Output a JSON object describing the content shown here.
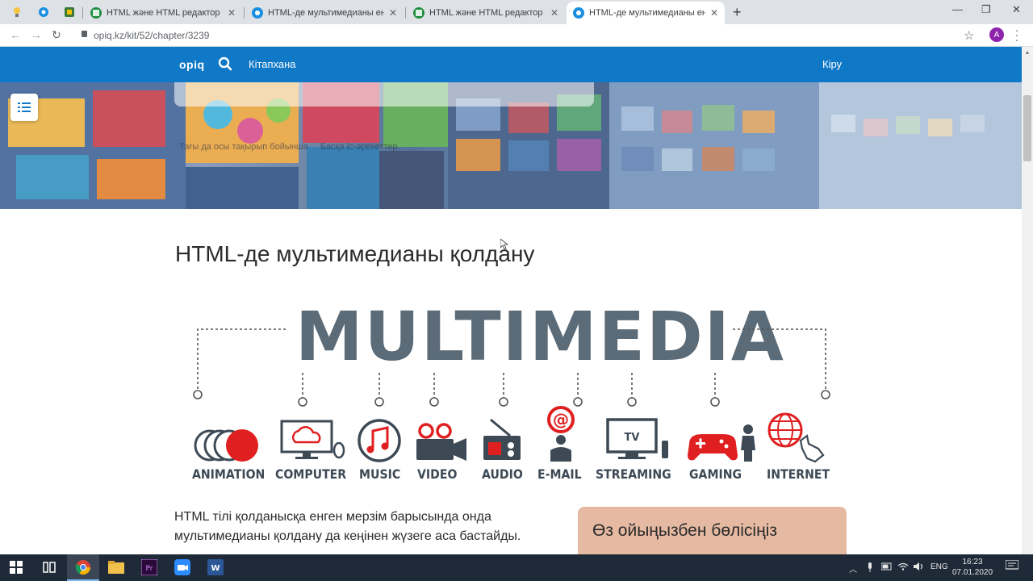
{
  "browser": {
    "tabs": [
      {
        "title": "HTML және HTML редактор - и",
        "active": false
      },
      {
        "title": "HTML-де мультимедианы енгіз",
        "active": false
      },
      {
        "title": "HTML және HTML редактор - и",
        "active": false
      },
      {
        "title": "HTML-де мультимедианы енгіз",
        "active": true
      }
    ],
    "url": "opiq.kz/kit/52/chapter/3239",
    "profile_initial": "A"
  },
  "site": {
    "logo": "opiq",
    "nav_library": "Кітапхана",
    "login": "Кіру",
    "hero_links": [
      "Тағы да осы тақырып бойынша",
      "Басқа іс-әрекеттер"
    ]
  },
  "article": {
    "title": "HTML-де мультимедианы қолдану",
    "infographic": {
      "headline": "MULTIMEDIA",
      "items": [
        "ANIMATION",
        "COMPUTER",
        "MUSIC",
        "VIDEO",
        "AUDIO",
        "E-MAIL",
        "STREAMING",
        "GAMING",
        "INTERNET"
      ],
      "tv_badge": "TV"
    },
    "body_line1": "HTML тілі қолданысқа енген мерзім барысында онда",
    "body_line2": "мультимедианы қолдану да кеңінен жүзеге аса бастайды.",
    "share_title": "Өз ойыңызбен бөлісіңіз"
  },
  "taskbar": {
    "language": "ENG",
    "time": "16:23",
    "date": "07.01.2020"
  },
  "colors": {
    "brand_blue": "#1079c7",
    "accent_red": "#e02020",
    "share_card": "#e6baa2",
    "infographic_gray": "#5b6b78"
  }
}
